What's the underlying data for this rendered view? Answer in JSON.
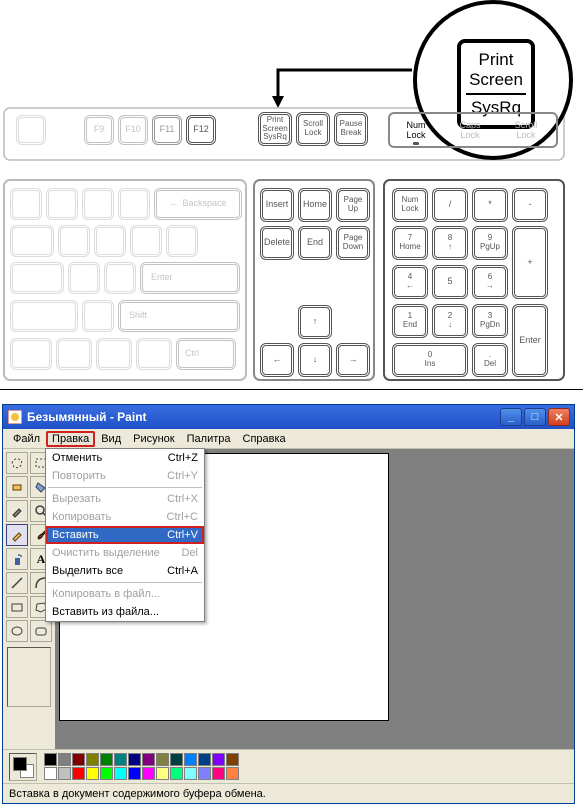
{
  "keyboard": {
    "callout": {
      "line1": "Print",
      "line2": "Screen",
      "line3": "SysRq"
    },
    "fkeys": [
      "F9",
      "F10",
      "F11",
      "F12"
    ],
    "sys": {
      "prtsc1": "Print",
      "prtsc2": "Screen",
      "prtsc3": "SysRq",
      "scrl1": "Scroll",
      "scrl2": "Lock",
      "pause1": "Pause",
      "pause2": "Break"
    },
    "lock": {
      "num": "Num",
      "lock": "Lock",
      "caps": "Caps",
      "scroll": "Scroll"
    },
    "nav": {
      "ins": "Insert",
      "home": "Home",
      "pgup1": "Page",
      "pgup2": "Up",
      "del": "Delete",
      "end": "End",
      "pgdn1": "Page",
      "pgdn2": "Down"
    },
    "numpad": {
      "nl1": "Num",
      "nl2": "Lock",
      "div": "/",
      "mul": "*",
      "sub": "-",
      "7a": "7",
      "7b": "Home",
      "8a": "8",
      "8b": "↑",
      "9a": "9",
      "9b": "PgUp",
      "plus": "+",
      "4a": "4",
      "4b": "←",
      "5": "5",
      "6a": "6",
      "6b": "→",
      "1a": "1",
      "1b": "End",
      "2a": "2",
      "2b": "↓",
      "3a": "3",
      "3b": "PgDn",
      "ent": "Enter",
      "0a": "0",
      "0b": "Ins",
      "dota": ".",
      "dotb": "Del"
    },
    "main": {
      "bksp": "Backspace",
      "enter": "Enter",
      "shift": "Shift",
      "ctrl": "Ctrl"
    }
  },
  "paint": {
    "title": "Безымянный - Paint",
    "menu": [
      "Файл",
      "Правка",
      "Вид",
      "Рисунок",
      "Палитра",
      "Справка"
    ],
    "edit_menu": [
      {
        "label": "Отменить",
        "sc": "Ctrl+Z",
        "dis": false
      },
      {
        "label": "Повторить",
        "sc": "Ctrl+Y",
        "dis": true
      },
      {
        "sep": true
      },
      {
        "label": "Вырезать",
        "sc": "Ctrl+X",
        "dis": true
      },
      {
        "label": "Копировать",
        "sc": "Ctrl+C",
        "dis": true
      },
      {
        "label": "Вставить",
        "sc": "Ctrl+V",
        "dis": false,
        "hl": true
      },
      {
        "label": "Очистить выделение",
        "sc": "Del",
        "dis": true
      },
      {
        "label": "Выделить все",
        "sc": "Ctrl+A",
        "dis": false
      },
      {
        "sep": true
      },
      {
        "label": "Копировать в файл...",
        "sc": "",
        "dis": true
      },
      {
        "label": "Вставить из файла...",
        "sc": "",
        "dis": false
      }
    ],
    "palette": {
      "row1": [
        "#000000",
        "#808080",
        "#800000",
        "#808000",
        "#008000",
        "#008080",
        "#000080",
        "#800080",
        "#808040",
        "#004040",
        "#0080ff",
        "#004080",
        "#8000ff",
        "#804000"
      ],
      "row2": [
        "#ffffff",
        "#c0c0c0",
        "#ff0000",
        "#ffff00",
        "#00ff00",
        "#00ffff",
        "#0000ff",
        "#ff00ff",
        "#ffff80",
        "#00ff80",
        "#80ffff",
        "#8080ff",
        "#ff0080",
        "#ff8040"
      ]
    },
    "status": "Вставка в документ содержимого буфера обмена."
  }
}
